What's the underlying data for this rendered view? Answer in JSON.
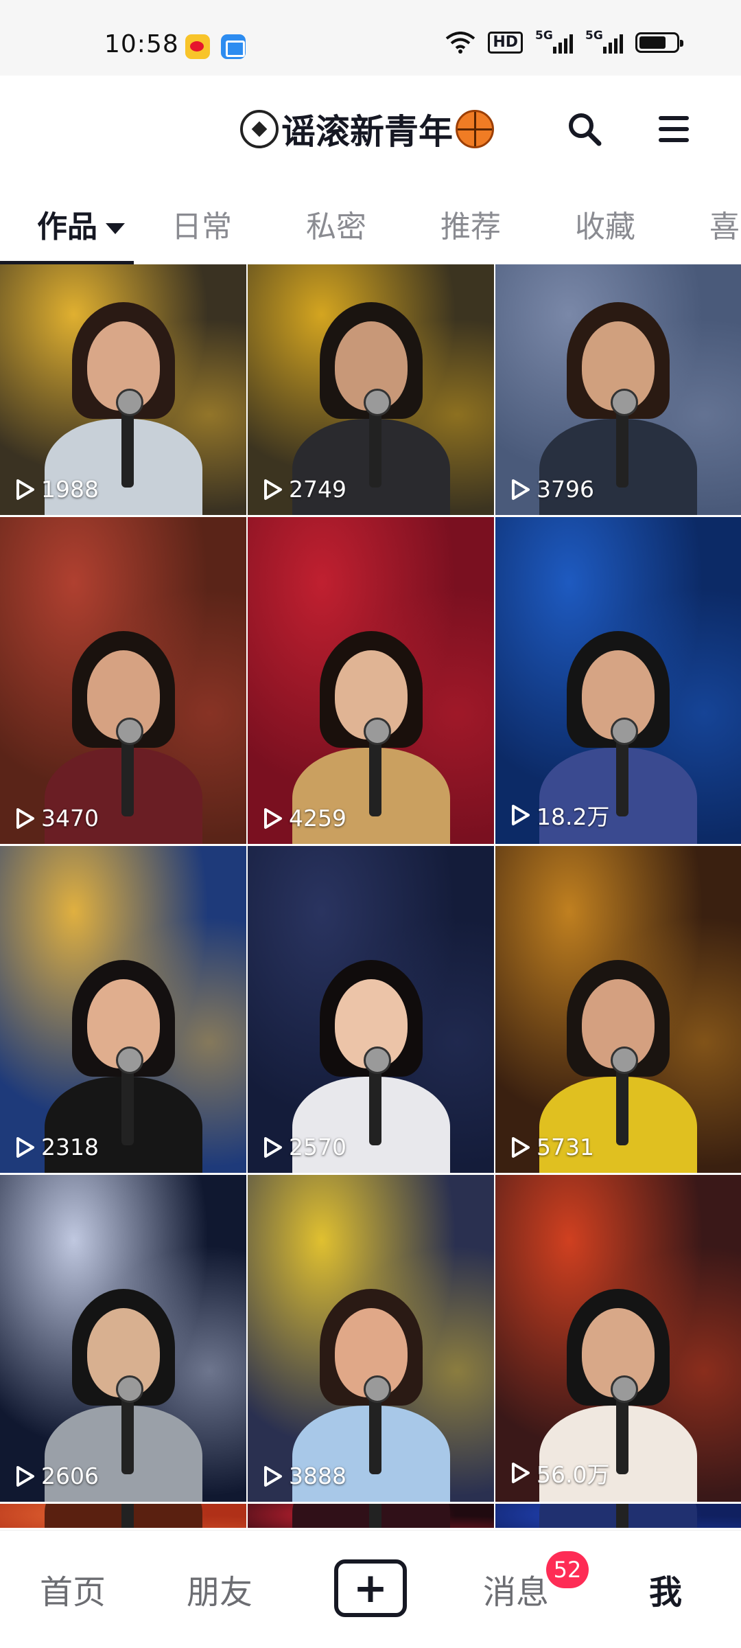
{
  "status_bar": {
    "time": "10:58",
    "apps": [
      "weibo-icon",
      "files-icon"
    ],
    "hd_label": "HD",
    "network_tags": [
      "5G",
      "5G"
    ]
  },
  "header": {
    "title": "谣滚新青年",
    "title_prefix_icon": "soccer-ball-icon",
    "title_suffix_icon": "basketball-icon",
    "search_icon": "search-icon",
    "menu_icon": "menu-icon"
  },
  "tabs": [
    {
      "label": "作品",
      "active": true
    },
    {
      "label": "日常",
      "active": false
    },
    {
      "label": "私密",
      "active": false
    },
    {
      "label": "推荐",
      "active": false
    },
    {
      "label": "收藏",
      "active": false
    },
    {
      "label": "喜",
      "active": false
    }
  ],
  "videos": [
    {
      "plays": "1988",
      "bg": "#3a3222",
      "accent": "#e0b030",
      "skin": "#d9a788",
      "hair": "#2a1a14",
      "shirt": "#c8d0d8"
    },
    {
      "plays": "2749",
      "bg": "#3c3420",
      "accent": "#d4a520",
      "skin": "#c89878",
      "hair": "#1a1410",
      "shirt": "#2a2a2e"
    },
    {
      "plays": "3796",
      "bg": "#4a5a7a",
      "accent": "#7a88a8",
      "skin": "#d0a07e",
      "hair": "#2a1a12",
      "shirt": "#283040"
    },
    {
      "plays": "3470",
      "bg": "#5a2418",
      "accent": "#b04030",
      "skin": "#d6a282",
      "hair": "#1a120e",
      "shirt": "#6a1e24"
    },
    {
      "plays": "4259",
      "bg": "#7a1020",
      "accent": "#c02030",
      "skin": "#e0b494",
      "hair": "#1a100c",
      "shirt": "#caa060"
    },
    {
      "plays": "18.2万",
      "bg": "#0c2a66",
      "accent": "#1e5ac0",
      "skin": "#d6a484",
      "hair": "#141414",
      "shirt": "#3a4a90"
    },
    {
      "plays": "2318",
      "bg": "#1e3a7a",
      "accent": "#e0b040",
      "skin": "#e0ae8e",
      "hair": "#141010",
      "shirt": "#161616"
    },
    {
      "plays": "2570",
      "bg": "#141c3a",
      "accent": "#2a3460",
      "skin": "#ecc4a8",
      "hair": "#100c0c",
      "shirt": "#e8e8ec"
    },
    {
      "plays": "5731",
      "bg": "#3a2010",
      "accent": "#c08020",
      "skin": "#d4a080",
      "hair": "#1a1410",
      "shirt": "#e0c020"
    },
    {
      "plays": "2606",
      "bg": "#101830",
      "accent": "#c0c8e0",
      "skin": "#d8b090",
      "hair": "#141414",
      "shirt": "#9aa0a8"
    },
    {
      "plays": "3888",
      "bg": "#2a3050",
      "accent": "#e0c030",
      "skin": "#e0a888",
      "hair": "#2a1a14",
      "shirt": "#a8c8e8"
    },
    {
      "plays": "56.0万",
      "bg": "#3a1818",
      "accent": "#d04020",
      "skin": "#d8a888",
      "hair": "#141414",
      "shirt": "#f0e8e0"
    },
    {
      "plays": "",
      "bg": "#b03018",
      "accent": "#e06030",
      "skin": "#d0a080",
      "hair": "#141414",
      "shirt": "#5a2010"
    },
    {
      "plays": "",
      "bg": "#200a10",
      "accent": "#c02030",
      "skin": "#d0a080",
      "hair": "#141414",
      "shirt": "#301018"
    },
    {
      "plays": "",
      "bg": "#102060",
      "accent": "#2040b0",
      "skin": "#d0a080",
      "hair": "#141414",
      "shirt": "#203070"
    }
  ],
  "bottom_nav": {
    "home": "首页",
    "friends": "朋友",
    "add_icon": "plus-icon",
    "add_label": "+",
    "messages": "消息",
    "messages_badge": "52",
    "me": "我"
  }
}
